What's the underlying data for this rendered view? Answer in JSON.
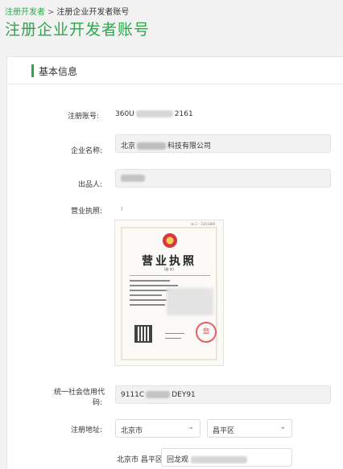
{
  "breadcrumb": {
    "parent": "注册开发者",
    "separator": ">",
    "current": "注册企业开发者账号"
  },
  "page_title": "注册企业开发者账号",
  "section": {
    "title": "基本信息"
  },
  "form": {
    "account": {
      "label": "注册账号:",
      "value_prefix": "360U",
      "value_suffix": "2161"
    },
    "company": {
      "label": "企业名称:",
      "value_prefix": "北京",
      "value_suffix": "科技有限公司"
    },
    "publisher": {
      "label": "出品人:",
      "value": ""
    },
    "license": {
      "label": "营业执照:",
      "marker": "ı"
    },
    "credit_code": {
      "label_line1": "统一社会信用代",
      "label_line2": "码:",
      "value_prefix": "9111C",
      "value_suffix": "DEY91"
    },
    "address": {
      "label": "注册地址:",
      "province": "北京市",
      "district": "昌平区",
      "detail_prefix": "北京市 昌平区",
      "detail_value": "回龙观"
    }
  },
  "license_image": {
    "title": "营业执照",
    "subtitle": "(副 本)",
    "seal": "章"
  },
  "colors": {
    "accent": "#2aa84a",
    "field_bg": "#f2f2f2"
  }
}
